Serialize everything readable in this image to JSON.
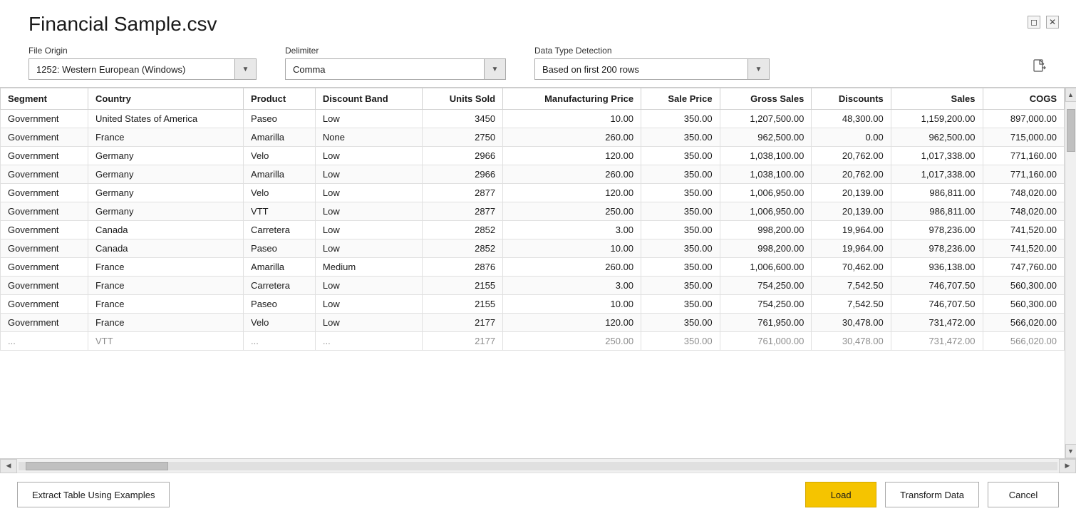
{
  "dialog": {
    "title": "Financial Sample.csv",
    "window_controls": {
      "restore": "🗖",
      "close": "✕"
    }
  },
  "controls": {
    "file_origin_label": "File Origin",
    "file_origin_value": "1252: Western European (Windows)",
    "delimiter_label": "Delimiter",
    "delimiter_value": "Comma",
    "data_type_label": "Data Type Detection",
    "data_type_value": "Based on first 200 rows"
  },
  "table": {
    "columns": [
      "Segment",
      "Country",
      "Product",
      "Discount Band",
      "Units Sold",
      "Manufacturing Price",
      "Sale Price",
      "Gross Sales",
      "Discounts",
      "Sales",
      "COGS"
    ],
    "rows": [
      [
        "Government",
        "United States of America",
        "Paseo",
        "Low",
        "3450",
        "10.00",
        "350.00",
        "1,207,500.00",
        "48,300.00",
        "1,159,200.00",
        "897,000.00"
      ],
      [
        "Government",
        "France",
        "Amarilla",
        "None",
        "2750",
        "260.00",
        "350.00",
        "962,500.00",
        "0.00",
        "962,500.00",
        "715,000.00"
      ],
      [
        "Government",
        "Germany",
        "Velo",
        "Low",
        "2966",
        "120.00",
        "350.00",
        "1,038,100.00",
        "20,762.00",
        "1,017,338.00",
        "771,160.00"
      ],
      [
        "Government",
        "Germany",
        "Amarilla",
        "Low",
        "2966",
        "260.00",
        "350.00",
        "1,038,100.00",
        "20,762.00",
        "1,017,338.00",
        "771,160.00"
      ],
      [
        "Government",
        "Germany",
        "Velo",
        "Low",
        "2877",
        "120.00",
        "350.00",
        "1,006,950.00",
        "20,139.00",
        "986,811.00",
        "748,020.00"
      ],
      [
        "Government",
        "Germany",
        "VTT",
        "Low",
        "2877",
        "250.00",
        "350.00",
        "1,006,950.00",
        "20,139.00",
        "986,811.00",
        "748,020.00"
      ],
      [
        "Government",
        "Canada",
        "Carretera",
        "Low",
        "2852",
        "3.00",
        "350.00",
        "998,200.00",
        "19,964.00",
        "978,236.00",
        "741,520.00"
      ],
      [
        "Government",
        "Canada",
        "Paseo",
        "Low",
        "2852",
        "10.00",
        "350.00",
        "998,200.00",
        "19,964.00",
        "978,236.00",
        "741,520.00"
      ],
      [
        "Government",
        "France",
        "Amarilla",
        "Medium",
        "2876",
        "260.00",
        "350.00",
        "1,006,600.00",
        "70,462.00",
        "936,138.00",
        "747,760.00"
      ],
      [
        "Government",
        "France",
        "Carretera",
        "Low",
        "2155",
        "3.00",
        "350.00",
        "754,250.00",
        "7,542.50",
        "746,707.50",
        "560,300.00"
      ],
      [
        "Government",
        "France",
        "Paseo",
        "Low",
        "2155",
        "10.00",
        "350.00",
        "754,250.00",
        "7,542.50",
        "746,707.50",
        "560,300.00"
      ],
      [
        "Government",
        "France",
        "Velo",
        "Low",
        "2177",
        "120.00",
        "350.00",
        "761,950.00",
        "30,478.00",
        "731,472.00",
        "566,020.00"
      ]
    ],
    "partial_row": [
      "...",
      "VTT",
      "...",
      "...",
      "2177",
      "250.00",
      "350.00",
      "761,000.00",
      "30,478.00",
      "731,472.00",
      "566,020.00"
    ]
  },
  "footer": {
    "extract_label": "Extract Table Using Examples",
    "load_label": "Load",
    "transform_label": "Transform Data",
    "cancel_label": "Cancel"
  }
}
